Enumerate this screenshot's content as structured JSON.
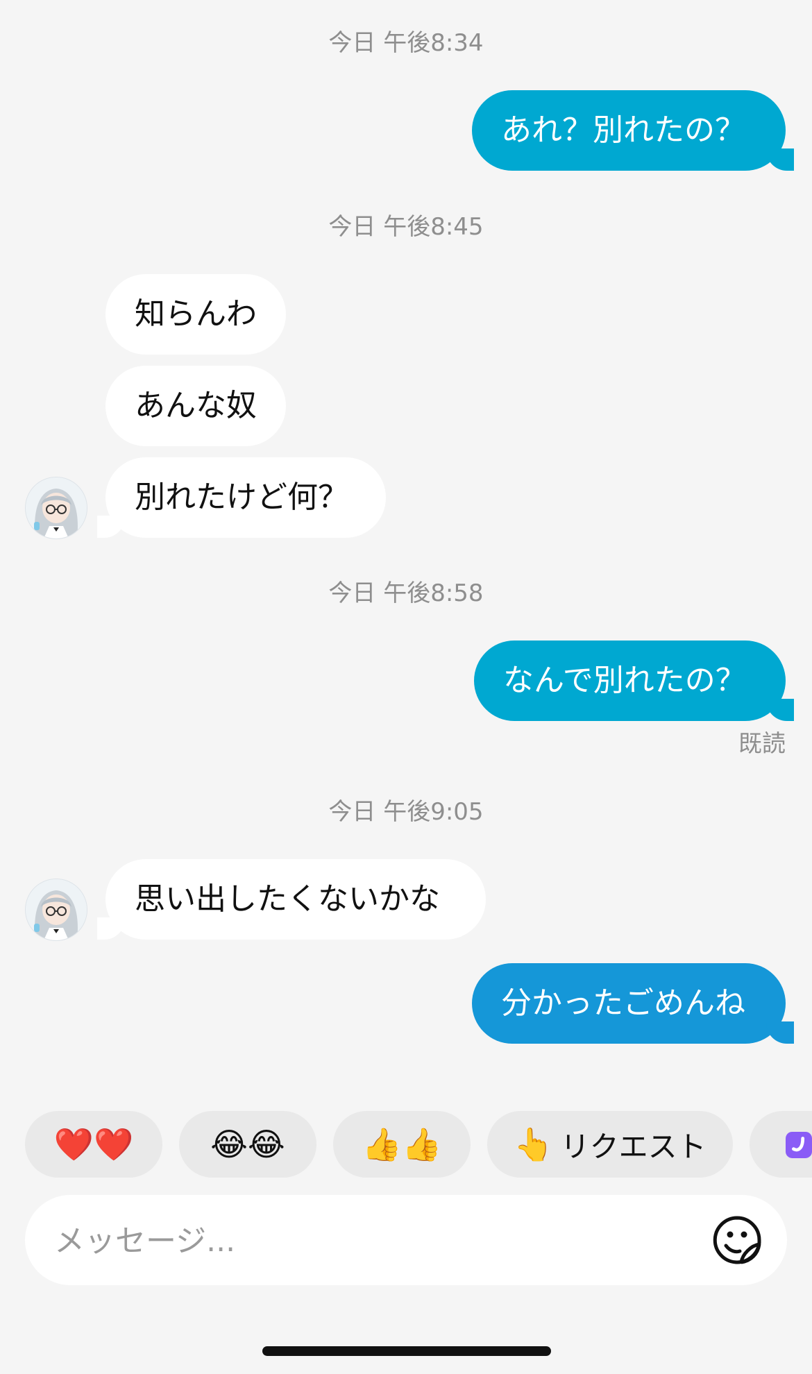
{
  "colors": {
    "background": "#f5f5f5",
    "outgoing_bubble": "#00a8d1",
    "outgoing_bubble_last": "#1597d8",
    "incoming_bubble": "#ffffff",
    "timestamp_text": "#8e8e8e",
    "chip_background": "#e9e9e9"
  },
  "messages": {
    "ts1": "今日 午後8:34",
    "m1": "あれ？別れたの？",
    "ts2": "今日 午後8:45",
    "m2": "知らんわ",
    "m3": "あんな奴",
    "m4": "別れたけど何？",
    "ts3": "今日 午後8:58",
    "m5": "なんで別れたの？",
    "read": "既読",
    "ts4": "今日 午後9:05",
    "m6": "思い出したくないかな",
    "m7": "分かったごめんね"
  },
  "quick_replies": [
    {
      "emoji": "❤️❤️",
      "icon": "heart-icon"
    },
    {
      "emoji": "😂😂",
      "icon": "laughing-face-icon"
    },
    {
      "emoji": "👍👍",
      "icon": "thumbs-up-icon"
    },
    {
      "emoji": "👆",
      "label": "リクエスト",
      "icon": "pointing-hand-icon"
    }
  ],
  "composer": {
    "placeholder": "メッセージ...",
    "sticker_icon": "sticker-icon"
  }
}
